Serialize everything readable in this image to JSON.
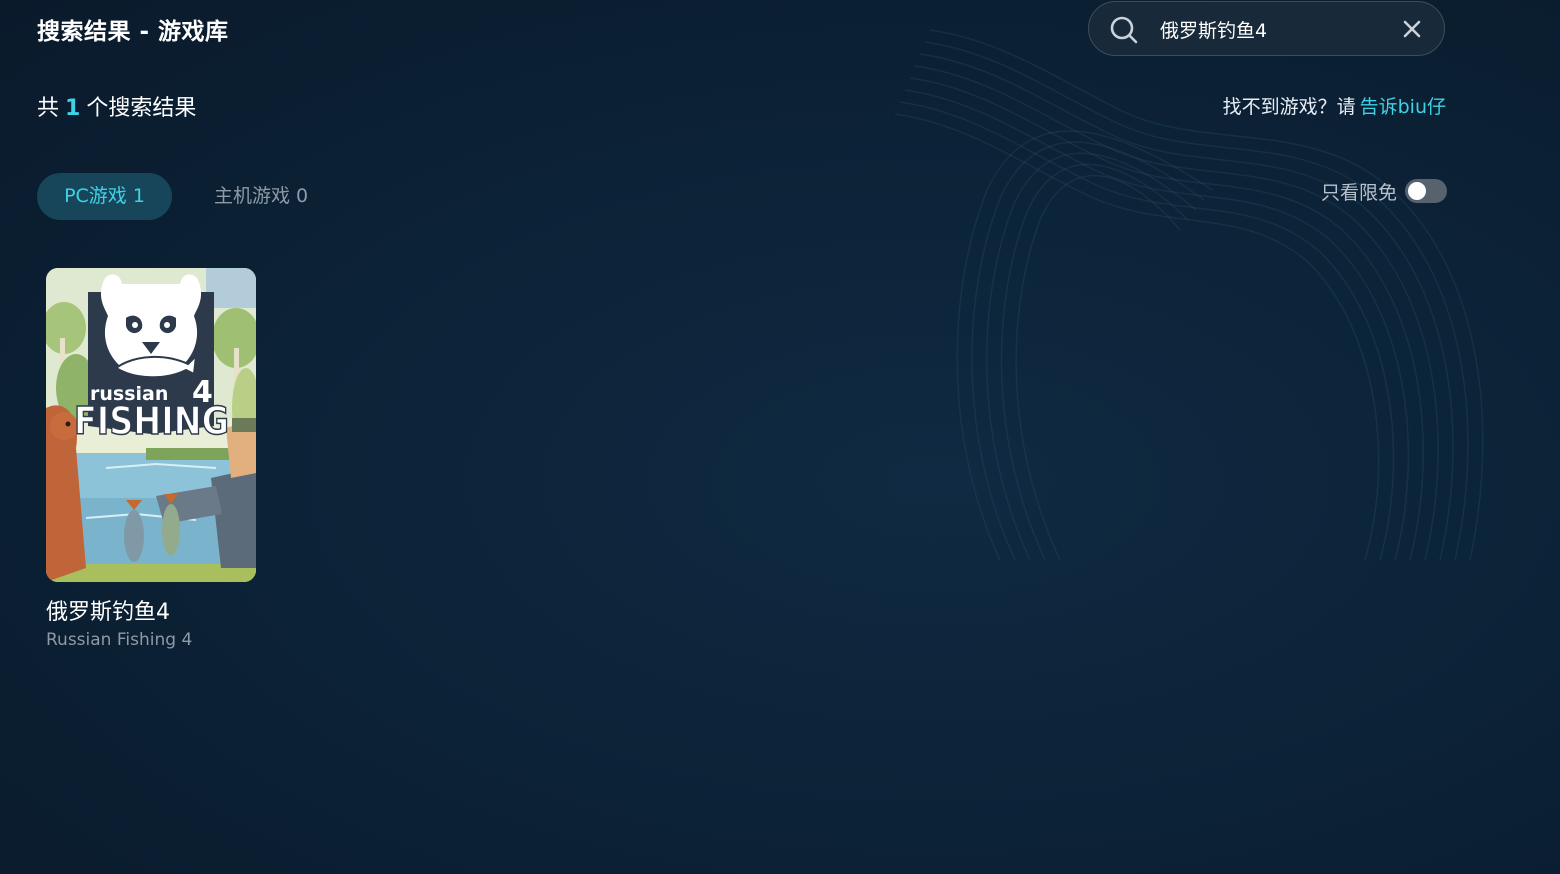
{
  "page": {
    "title": "搜索结果 - 游戏库"
  },
  "search": {
    "value": "俄罗斯钓鱼4"
  },
  "results": {
    "prefix": "共",
    "count": "1",
    "suffix": "个搜索结果"
  },
  "feedback": {
    "prompt": "找不到游戏？请",
    "link": "告诉biu仔"
  },
  "tabs": [
    {
      "label": "PC游戏 1",
      "active": true
    },
    {
      "label": "主机游戏 0",
      "active": false
    }
  ],
  "filter": {
    "free_only_label": "只看限免",
    "free_only_enabled": false
  },
  "games": [
    {
      "title": "俄罗斯钓鱼4",
      "subtitle": "Russian Fishing 4",
      "cover_logo_top": "russian",
      "cover_logo_bottom": "FISHING",
      "cover_logo_number": "4"
    }
  ],
  "colors": {
    "accent": "#3fd2e6",
    "tab_active_bg": "#17465a",
    "background": "#0c2338"
  }
}
